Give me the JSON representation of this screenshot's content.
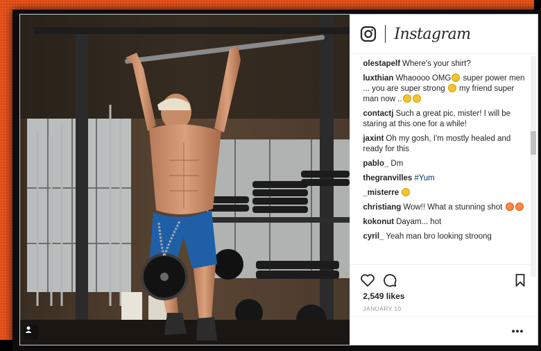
{
  "brand": {
    "wordmark": "Instagram",
    "logo_icon": "instagram-camera-icon"
  },
  "colors": {
    "frame_orange": "#e8541c",
    "text": "#262626",
    "hashtag": "#003569",
    "muted": "#999999"
  },
  "comments": [
    {
      "user": "olestapelf",
      "parts": [
        {
          "text": "Where's your shirt?"
        }
      ]
    },
    {
      "user": "luxthian",
      "parts": [
        {
          "text": "Whaoooo OMG"
        },
        {
          "emoji": "face-screaming"
        },
        {
          "text": " super power men ... you are super strong "
        },
        {
          "emoji": "flexed-biceps"
        },
        {
          "text": " my friend super man now .."
        },
        {
          "emoji": "smiling-face"
        },
        {
          "emoji": "smiling-face"
        }
      ]
    },
    {
      "user": "contactj",
      "parts": [
        {
          "text": "Such a great pic, mister! I will be staring at this one for a while!"
        }
      ]
    },
    {
      "user": "jaxint",
      "parts": [
        {
          "text": "Oh my gosh, I'm mostly healed and ready for this"
        }
      ]
    },
    {
      "user": "pablo_",
      "parts": [
        {
          "text": "Dm"
        }
      ]
    },
    {
      "user": "thegranvilles",
      "parts": [
        {
          "text": "#Yum",
          "hashtag": true
        }
      ]
    },
    {
      "user": "_misterre",
      "parts": [
        {
          "emoji": "smiling-face"
        }
      ]
    },
    {
      "user": "christiang",
      "parts": [
        {
          "text": "Wow!! What a stunning shot "
        },
        {
          "emoji": "heart-eyes",
          "red": true
        },
        {
          "emoji": "heart-eyes",
          "red": true
        }
      ]
    },
    {
      "user": "kokonut",
      "parts": [
        {
          "text": "Dayam... hot"
        }
      ]
    },
    {
      "user": "cyril_",
      "parts": [
        {
          "text": "Yeah man bro looking stroong"
        }
      ]
    }
  ],
  "actions": {
    "like_icon": "heart-icon",
    "comment_icon": "comment-bubble-icon",
    "save_icon": "bookmark-icon"
  },
  "likes_label": "2,549 likes",
  "date_label": "JANUARY 10",
  "more_label": "•••"
}
